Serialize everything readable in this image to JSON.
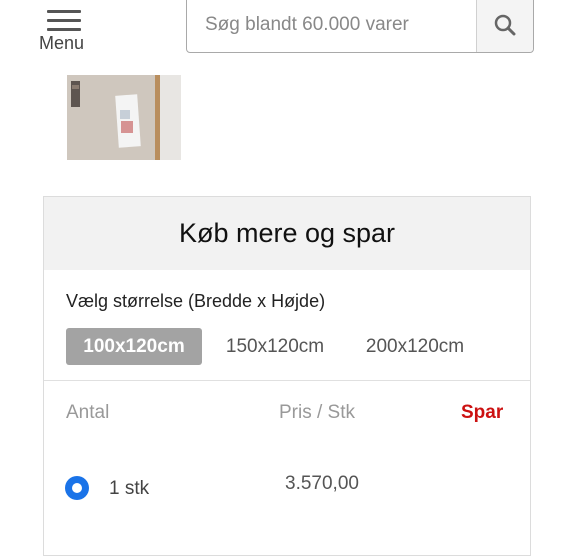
{
  "header": {
    "menu_label": "Menu",
    "search_placeholder": "Søg blandt 60.000 varer"
  },
  "panel": {
    "title": "Køb mere og spar",
    "size_label": "Vælg størrelse (Bredde x Højde)",
    "sizes": [
      {
        "label": "100x120cm",
        "selected": true
      },
      {
        "label": "150x120cm",
        "selected": false
      },
      {
        "label": "200x120cm",
        "selected": false
      }
    ],
    "columns": {
      "quantity": "Antal",
      "price": "Pris / Stk",
      "save": "Spar"
    },
    "rows": [
      {
        "quantity": "1 stk",
        "price": "3.570,00",
        "save": "",
        "selected": true
      }
    ]
  },
  "colors": {
    "accent": "#1a73e8",
    "save_red": "#cc1111",
    "selected_size_bg": "#a3a3a3"
  },
  "icons": [
    "menu-icon",
    "search-icon"
  ]
}
